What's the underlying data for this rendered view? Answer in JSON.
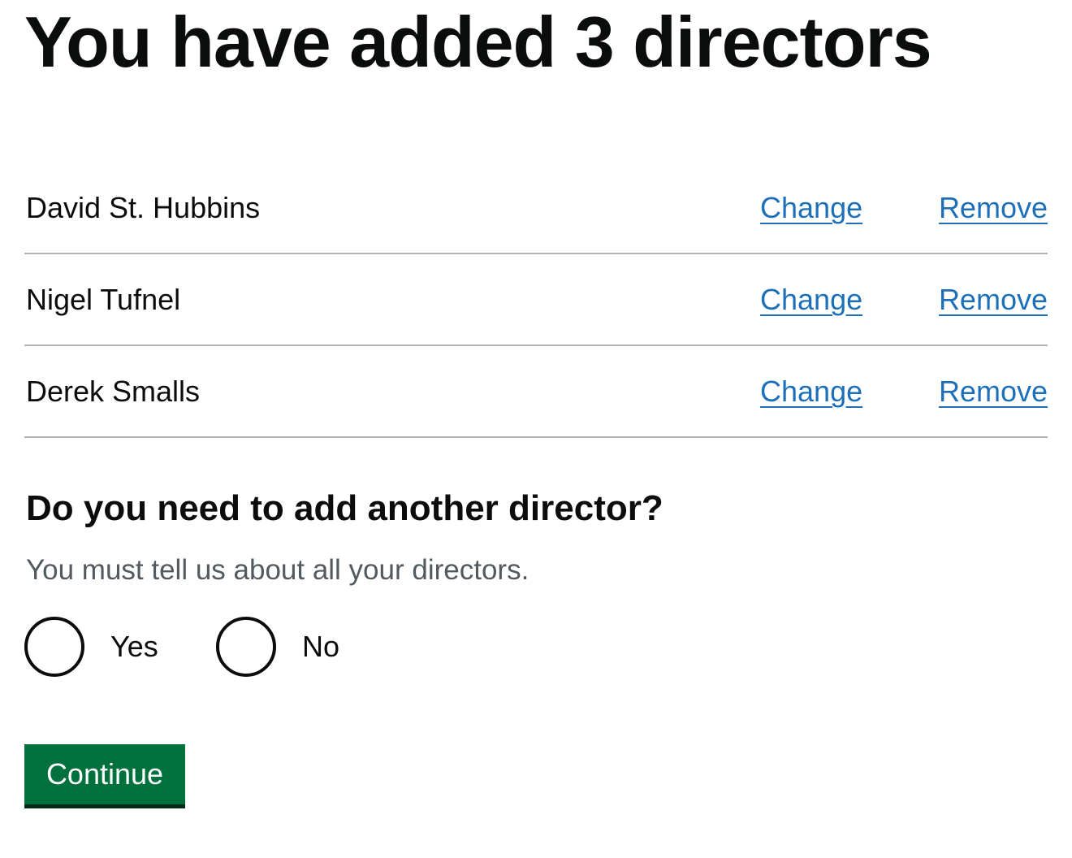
{
  "heading": "You have added 3 directors",
  "directors": [
    {
      "name": "David St. Hubbins",
      "change_label": "Change",
      "remove_label": "Remove"
    },
    {
      "name": "Nigel Tufnel",
      "change_label": "Change",
      "remove_label": "Remove"
    },
    {
      "name": "Derek Smalls",
      "change_label": "Change",
      "remove_label": "Remove"
    }
  ],
  "question": {
    "title": "Do you need to add another director?",
    "hint": "You must tell us about all your directors.",
    "options": [
      {
        "label": "Yes",
        "selected": false
      },
      {
        "label": "No",
        "selected": false
      }
    ]
  },
  "continue_label": "Continue",
  "colors": {
    "text": "#0b0c0c",
    "link": "#1d70b8",
    "hint": "#505a5f",
    "border": "#b1b4b6",
    "button": "#00703c",
    "button_shadow": "#002d18"
  }
}
